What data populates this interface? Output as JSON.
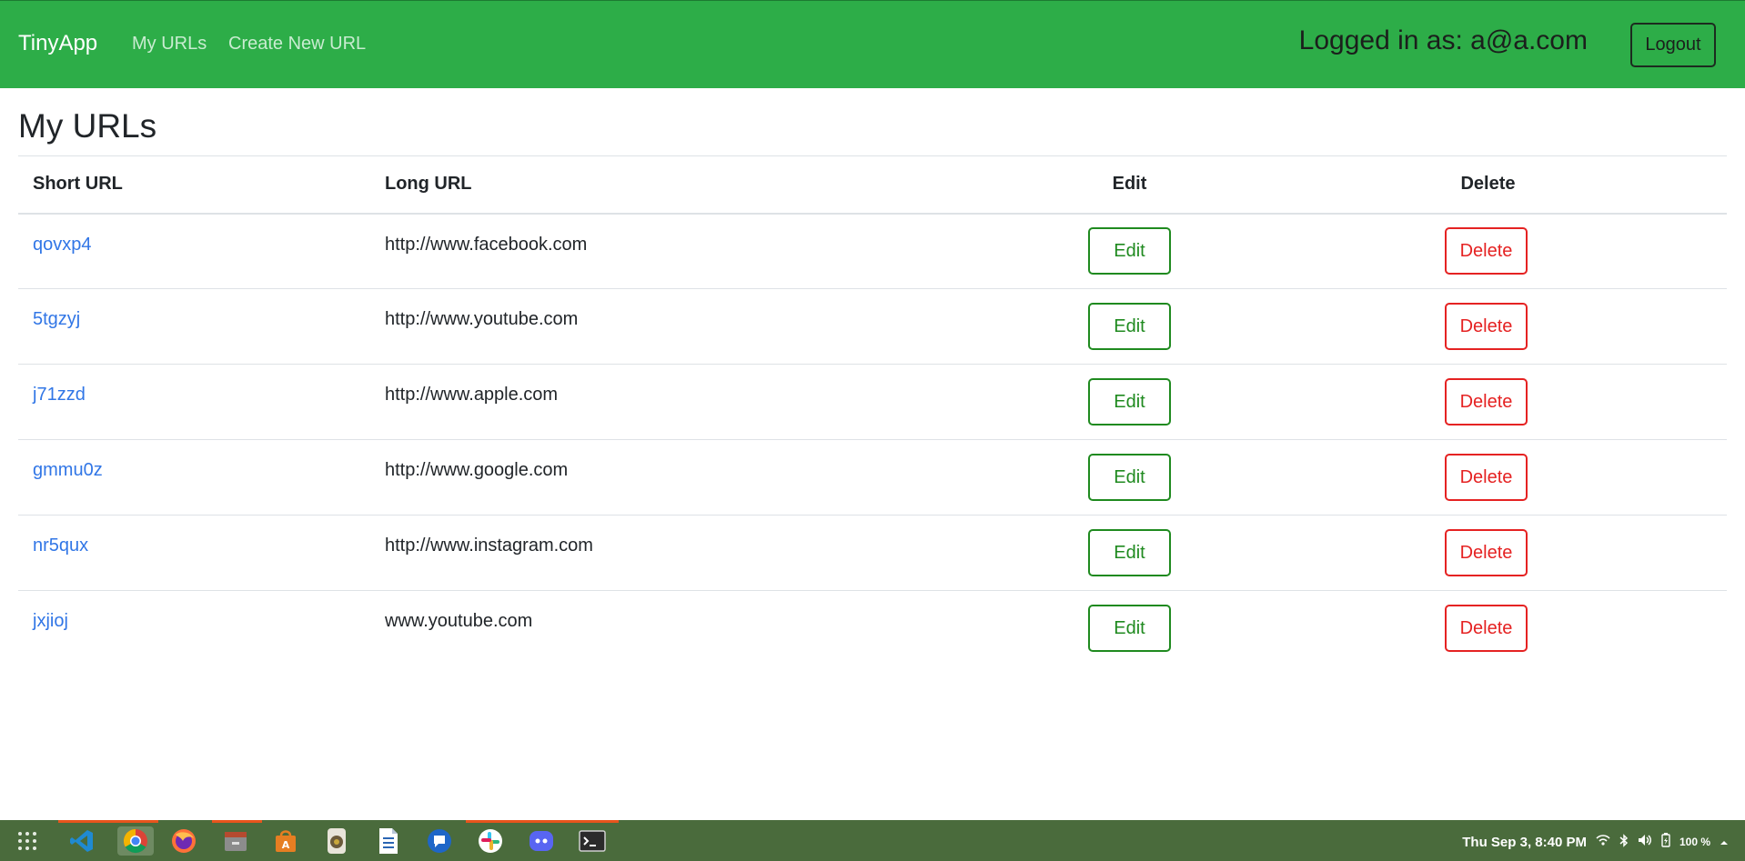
{
  "nav": {
    "brand": "TinyApp",
    "links": [
      "My URLs",
      "Create New URL"
    ],
    "logged_in": "Logged in as: a@a.com",
    "logout": "Logout"
  },
  "page_title": "My URLs",
  "table": {
    "headers": [
      "Short URL",
      "Long URL",
      "Edit",
      "Delete"
    ],
    "rows": [
      {
        "short": "qovxp4",
        "long": "http://www.facebook.com",
        "edit": "Edit",
        "delete": "Delete"
      },
      {
        "short": "5tgzyj",
        "long": "http://www.youtube.com",
        "edit": "Edit",
        "delete": "Delete"
      },
      {
        "short": "j71zzd",
        "long": "http://www.apple.com",
        "edit": "Edit",
        "delete": "Delete"
      },
      {
        "short": "gmmu0z",
        "long": "http://www.google.com",
        "edit": "Edit",
        "delete": "Delete"
      },
      {
        "short": "nr5qux",
        "long": "http://www.instagram.com",
        "edit": "Edit",
        "delete": "Delete"
      },
      {
        "short": "jxjioj",
        "long": "www.youtube.com",
        "edit": "Edit",
        "delete": "Delete"
      }
    ]
  },
  "taskbar": {
    "apps": [
      "app-grid-icon",
      "vscode-icon",
      "chrome-icon",
      "firefox-icon",
      "files-icon",
      "software-store-icon",
      "audio-icon",
      "writer-icon",
      "messages-icon",
      "slack-icon",
      "discord-icon",
      "terminal-icon"
    ],
    "clock": "Thu Sep  3,  8:40 PM",
    "battery": "100 %"
  },
  "colors": {
    "navbar": "#2dad48",
    "link": "#3176e6",
    "edit": "#1f8a1f",
    "delete": "#e52222",
    "taskbar": "#4a6b3c"
  }
}
